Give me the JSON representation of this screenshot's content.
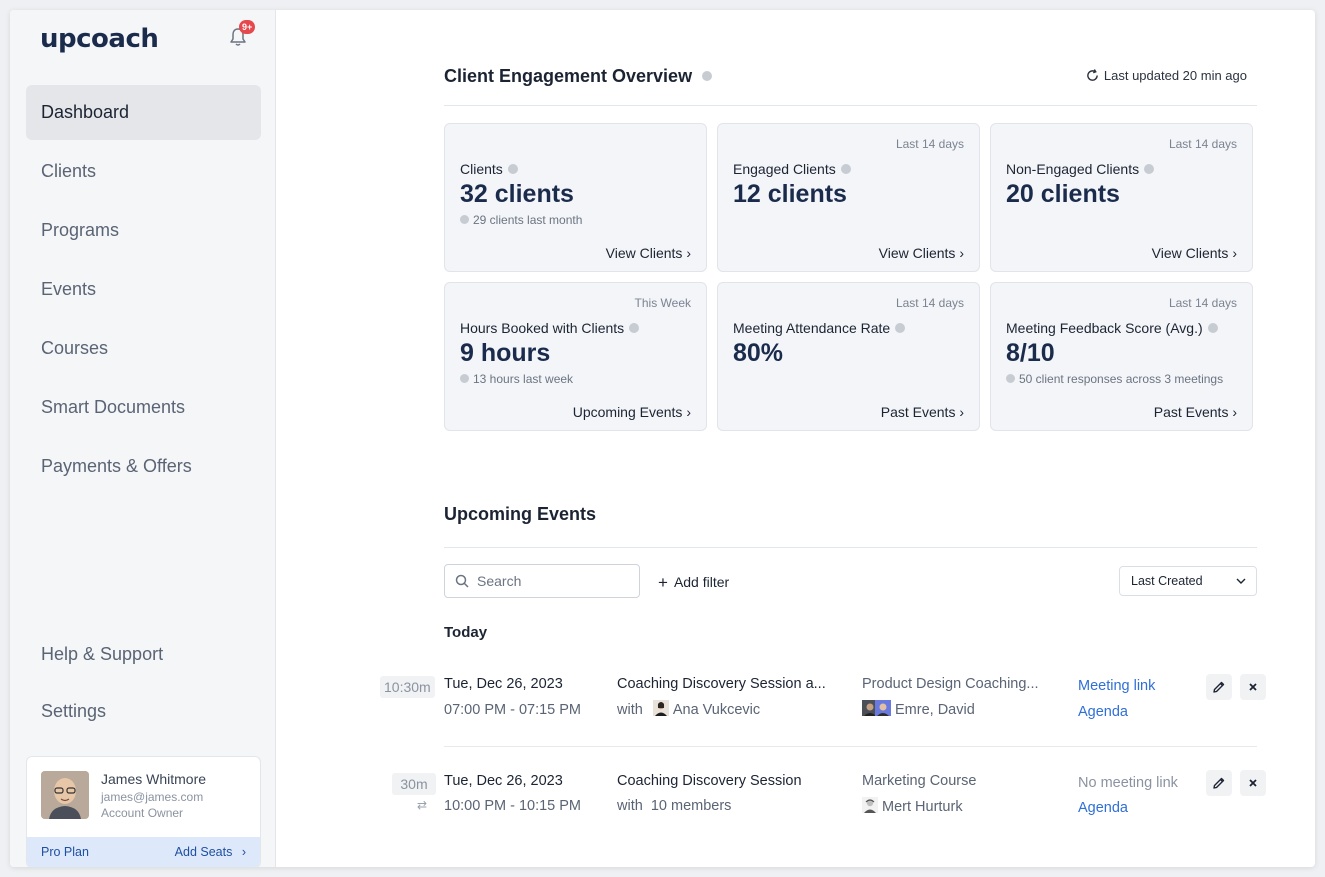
{
  "sidebar": {
    "logo": "upcoach",
    "notification_badge": "9+",
    "nav": [
      {
        "label": "Dashboard",
        "active": true
      },
      {
        "label": "Clients"
      },
      {
        "label": "Programs"
      },
      {
        "label": "Events"
      },
      {
        "label": "Courses"
      },
      {
        "label": "Smart Documents"
      },
      {
        "label": "Payments & Offers"
      }
    ],
    "bottom_nav": [
      {
        "label": "Help & Support"
      },
      {
        "label": "Settings"
      }
    ],
    "profile": {
      "name": "James Whitmore",
      "email": "james@james.com",
      "role": "Account Owner",
      "plan": "Pro Plan",
      "add_seats": "Add Seats"
    }
  },
  "overview": {
    "title": "Client Engagement Overview",
    "last_updated": "Last updated 20 min ago",
    "cards": [
      {
        "period": "",
        "label": "Clients",
        "value": "32 clients",
        "sub": "29 clients last month",
        "link": "View Clients"
      },
      {
        "period": "Last 14 days",
        "label": "Engaged Clients",
        "value": "12 clients",
        "sub": "",
        "link": "View Clients"
      },
      {
        "period": "Last 14 days",
        "label": "Non-Engaged Clients",
        "value": "20 clients",
        "sub": "",
        "link": "View Clients"
      },
      {
        "period": "This Week",
        "label": "Hours Booked with Clients",
        "value": "9 hours",
        "sub": "13 hours last week",
        "link": "Upcoming Events"
      },
      {
        "period": "Last 14 days",
        "label": "Meeting Attendance Rate",
        "value": "80%",
        "sub": "",
        "link": "Past Events"
      },
      {
        "period": "Last 14 days",
        "label": "Meeting Feedback Score (Avg.)",
        "value": "8/10",
        "sub": "50 client responses across 3 meetings",
        "link": "Past Events"
      }
    ]
  },
  "events": {
    "title": "Upcoming Events",
    "search_placeholder": "Search",
    "add_filter": "Add filter",
    "sort": "Last Created",
    "group_label": "Today",
    "items": [
      {
        "duration": "10:30m",
        "date": "Tue, Dec 26, 2023",
        "time": "07:00 PM - 07:15 PM",
        "title": "Coaching Discovery Session a...",
        "with_label": "with",
        "with_name": "Ana Vukcevic",
        "course": "Product Design Coaching...",
        "people": "Emre, David",
        "meeting": "Meeting link",
        "agenda": "Agenda"
      },
      {
        "duration": "30m",
        "date": "Tue, Dec 26, 2023",
        "time": "10:00 PM - 10:15 PM",
        "title": "Coaching Discovery Session",
        "with_label": "with",
        "with_name": "10 members",
        "course": "Marketing Course",
        "people": "Mert Hurturk",
        "meeting": "No meeting link",
        "agenda": "Agenda"
      }
    ]
  },
  "colors": {
    "accent": "#2f6fd6",
    "brand": "#1a2b4c",
    "badge": "#e5484d",
    "plan_bar": "#dde9fb"
  }
}
